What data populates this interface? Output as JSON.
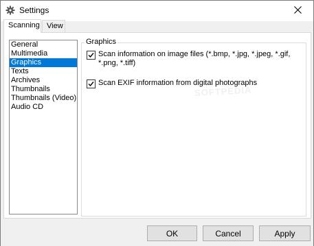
{
  "window": {
    "title": "Settings"
  },
  "tabs": [
    {
      "label": "Scanning",
      "active": true
    },
    {
      "label": "View",
      "active": false
    }
  ],
  "categories": {
    "items": [
      {
        "label": "General",
        "selected": false
      },
      {
        "label": "Multimedia",
        "selected": false
      },
      {
        "label": "Graphics",
        "selected": true
      },
      {
        "label": "Texts",
        "selected": false
      },
      {
        "label": "Archives",
        "selected": false
      },
      {
        "label": "Thumbnails",
        "selected": false
      },
      {
        "label": "Thumbnails (Video)",
        "selected": false
      },
      {
        "label": "Audio CD",
        "selected": false
      }
    ]
  },
  "group": {
    "label": "Graphics",
    "options": [
      {
        "label": "Scan information on image files (*.bmp, *.jpg, *.jpeg, *.gif, *.png, *.tiff)",
        "checked": true
      },
      {
        "label": "Scan EXIF information from digital photographs",
        "checked": true
      }
    ]
  },
  "watermark": "SOFTPEDIA",
  "buttons": {
    "ok": "OK",
    "cancel": "Cancel",
    "apply": "Apply"
  },
  "icons": {
    "app": "gear-icon",
    "close": "close-icon",
    "check": "check-icon"
  },
  "colors": {
    "selection": "#0078d7",
    "window_bg": "#f0f0f0",
    "panel_bg": "#ffffff"
  }
}
